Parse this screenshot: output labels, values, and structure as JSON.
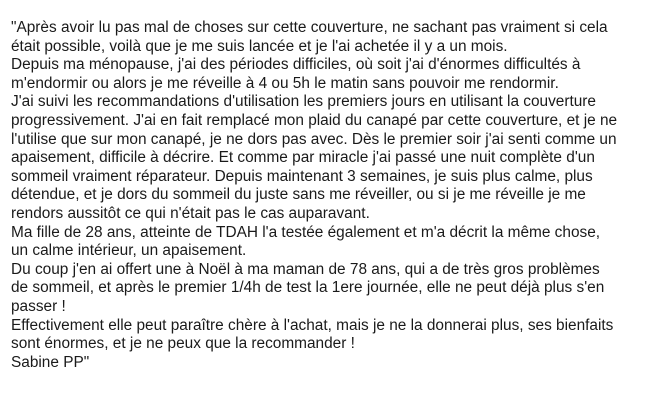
{
  "testimonial": {
    "lines": [
      "\"Après avoir lu pas mal de choses sur cette couverture, ne sachant pas vraiment si cela",
      "était possible, voilà que je me suis lancée et je l'ai achetée il y a un mois.",
      "Depuis ma ménopause, j'ai des périodes difficiles, où soit j'ai d'énormes difficultés à",
      "m'endormir ou alors je me réveille à 4 ou 5h le matin sans pouvoir me rendormir.",
      "J'ai suivi les recommandations d'utilisation les premiers jours en utilisant la couverture",
      "progressivement. J'ai en fait remplacé mon plaid du canapé par cette couverture, et je ne",
      "l'utilise que sur mon canapé, je ne dors pas avec. Dès le premier soir j'ai senti comme un",
      "apaisement, difficile à décrire. Et comme par miracle j'ai passé une nuit complète d'un",
      "sommeil vraiment réparateur. Depuis maintenant 3 semaines, je suis plus calme, plus",
      "détendue, et je dors du sommeil du juste sans me réveiller, ou si je me réveille je me",
      "rendors aussitôt ce qui n'était pas le cas auparavant.",
      "Ma fille de 28 ans, atteinte de TDAH l'a testée également et m'a décrit la même chose,",
      "un calme intérieur, un apaisement.",
      "Du coup j'en ai offert une à Noël à ma maman de 78 ans, qui a de très gros problèmes",
      "de sommeil, et après le premier 1/4h de test la 1ere journée, elle ne peut déjà plus s'en",
      "passer !",
      "Effectivement elle peut paraître chère à l'achat, mais je ne la donnerai plus, ses bienfaits",
      "sont énormes, et je ne peux que la recommander !",
      "Sabine PP\""
    ]
  }
}
